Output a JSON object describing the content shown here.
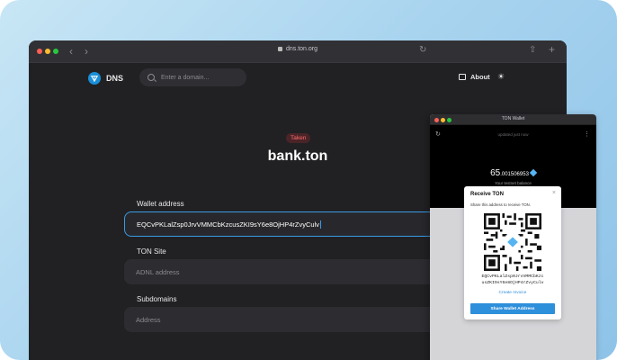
{
  "browser": {
    "url": "dns.ton.org",
    "traffic_colors": [
      "#ff5f57",
      "#febc2e",
      "#28c840"
    ]
  },
  "header": {
    "brand": "DNS",
    "search_placeholder": "Enter a domain...",
    "about_label": "About"
  },
  "domain": {
    "status": "Taken",
    "name": "bank.ton"
  },
  "form": {
    "wallet_label": "Wallet address",
    "wallet_value": "EQCvPKLalZsp0JrvVMMCbKzcusZKI9sY6e8OjHP4rZvyCulv",
    "site_label": "TON Site",
    "site_placeholder": "ADNL address",
    "subdomains_label": "Subdomains",
    "subdomains_placeholder": "Address"
  },
  "wallet": {
    "window_title": "TON Wallet",
    "updated": "updated just now",
    "balance_int": "65",
    "balance_frac": ".001506953",
    "balance_caption": "Your testnet balance",
    "modal": {
      "title": "Receive TON",
      "description": "Share this address to receive TON.",
      "address_line1": "EQCvPKLalZsp0JrvVMMCbKzc",
      "address_line2": "usZKI9sY6e8OjHP4rZvyCulv",
      "create_invoice": "Create Invoice",
      "share_button": "Share Wallet Address"
    }
  },
  "colors": {
    "accent": "#2e8fdb",
    "taken_bg": "#4a2428",
    "taken_text": "#ff6b6b",
    "page_bg": "#212124"
  }
}
